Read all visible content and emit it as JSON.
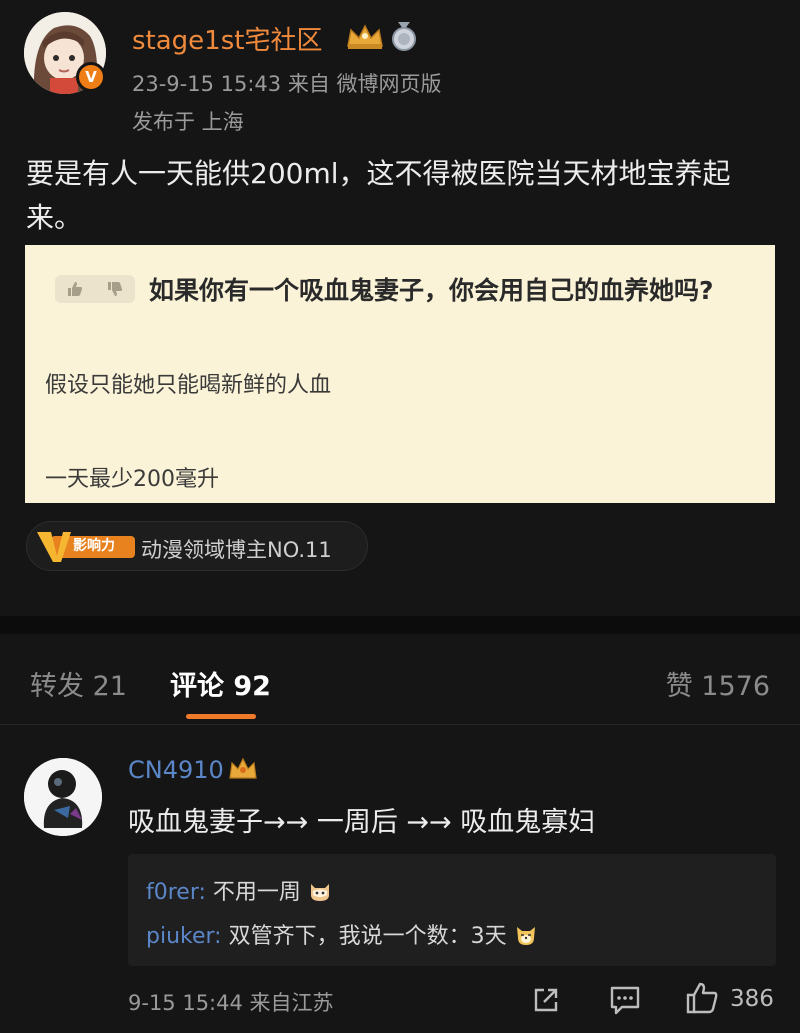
{
  "post": {
    "username": "stage1st宅社区",
    "verified_badge": "V",
    "meta_line": "23-9-15 15:43  来自 微博网页版",
    "location_line": "发布于 上海",
    "text": "要是有人一天能供200ml，这不得被医院当天材地宝养起来。",
    "icons": [
      "avatar",
      "verified-icon",
      "crown-icon",
      "medal-icon"
    ]
  },
  "quote": {
    "title": "如果你有一个吸血鬼妻子，你会用自己的血养她吗?",
    "line1": "假设只能她只能喝新鲜的人血",
    "line2": "一天最少200毫升",
    "icons": [
      "thumb-up-icon",
      "thumb-down-icon"
    ]
  },
  "influence": {
    "badge_label": "影响力",
    "badge_letter": "V",
    "text": "动漫领域博主NO.11"
  },
  "tabs": {
    "repost": "转发 21",
    "comment": "评论 92",
    "like": "赞 1576"
  },
  "comment": {
    "username": "CN4910",
    "text": "吸血鬼妻子→→ 一周后 →→ 吸血鬼寡妇",
    "replies": [
      {
        "name": "f0rer:",
        "text": " 不用一周",
        "emoji": "cat-emoji"
      },
      {
        "name": "piuker:",
        "text": " 双管齐下，我说一个数：3天",
        "emoji": "dog-emoji"
      }
    ],
    "meta": "9-15 15:44 来自江苏",
    "like_count": "386",
    "icons": [
      "share-icon",
      "comment-icon",
      "like-icon"
    ]
  },
  "colors": {
    "background": "#151515",
    "username_orange": "#f08a3c",
    "link_blue": "#5b86c8",
    "card_bg": "#fbf3d7",
    "tab_accent": "#ee7a2a"
  }
}
